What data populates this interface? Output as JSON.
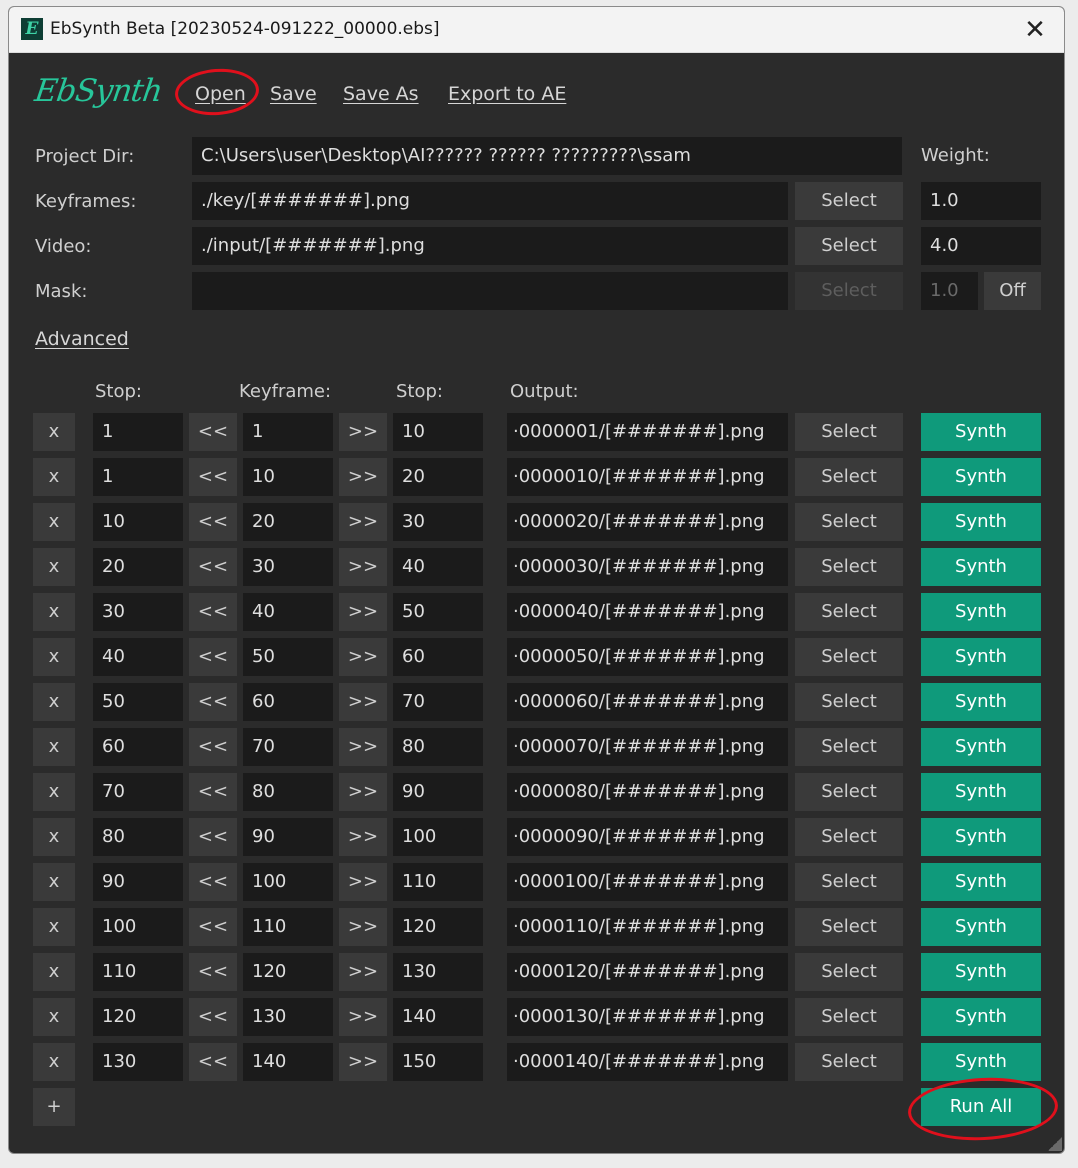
{
  "window": {
    "title": "EbSynth Beta [20230524-091222_00000.ebs]",
    "close_glyph": "✕"
  },
  "logo": "EbSynth",
  "menu": {
    "open": "Open",
    "save": "Save",
    "save_as": "Save As",
    "export": "Export to AE"
  },
  "project": {
    "dir_label": "Project Dir:",
    "dir_value": "C:\\Users\\user\\Desktop\\AI?????? ?????? ?????????\\ssam",
    "weight_label": "Weight:",
    "keyframes_label": "Keyframes:",
    "keyframes_value": "./key/[#######].png",
    "keyframes_weight": "1.0",
    "video_label": "Video:",
    "video_value": "./input/[#######].png",
    "video_weight": "4.0",
    "mask_label": "Mask:",
    "mask_value": "",
    "mask_weight": "1.0",
    "mask_toggle": "Off",
    "select_label": "Select"
  },
  "advanced": "Advanced",
  "columns": {
    "stop1": "Stop:",
    "keyframe": "Keyframe:",
    "stop2": "Stop:",
    "output": "Output:"
  },
  "row_labels": {
    "remove": "x",
    "prev": "<<",
    "next": ">>",
    "select": "Select",
    "synth": "Synth"
  },
  "rows": [
    {
      "stop": "1",
      "keyframe": "1",
      "stop_end": "10",
      "output": "·0000001/[#######].png"
    },
    {
      "stop": "1",
      "keyframe": "10",
      "stop_end": "20",
      "output": "·0000010/[#######].png"
    },
    {
      "stop": "10",
      "keyframe": "20",
      "stop_end": "30",
      "output": "·0000020/[#######].png"
    },
    {
      "stop": "20",
      "keyframe": "30",
      "stop_end": "40",
      "output": "·0000030/[#######].png"
    },
    {
      "stop": "30",
      "keyframe": "40",
      "stop_end": "50",
      "output": "·0000040/[#######].png"
    },
    {
      "stop": "40",
      "keyframe": "50",
      "stop_end": "60",
      "output": "·0000050/[#######].png"
    },
    {
      "stop": "50",
      "keyframe": "60",
      "stop_end": "70",
      "output": "·0000060/[#######].png"
    },
    {
      "stop": "60",
      "keyframe": "70",
      "stop_end": "80",
      "output": "·0000070/[#######].png"
    },
    {
      "stop": "70",
      "keyframe": "80",
      "stop_end": "90",
      "output": "·0000080/[#######].png"
    },
    {
      "stop": "80",
      "keyframe": "90",
      "stop_end": "100",
      "output": "·0000090/[#######].png"
    },
    {
      "stop": "90",
      "keyframe": "100",
      "stop_end": "110",
      "output": "·0000100/[#######].png"
    },
    {
      "stop": "100",
      "keyframe": "110",
      "stop_end": "120",
      "output": "·0000110/[#######].png"
    },
    {
      "stop": "110",
      "keyframe": "120",
      "stop_end": "130",
      "output": "·0000120/[#######].png"
    },
    {
      "stop": "120",
      "keyframe": "130",
      "stop_end": "140",
      "output": "·0000130/[#######].png"
    },
    {
      "stop": "130",
      "keyframe": "140",
      "stop_end": "150",
      "output": "·0000140/[#######].png"
    }
  ],
  "add_row": "+",
  "run_all": "Run All",
  "colors": {
    "accent": "#0f9a7b",
    "background": "#2b2b2b",
    "field": "#1b1b1b",
    "annotation": "#e0101c"
  }
}
